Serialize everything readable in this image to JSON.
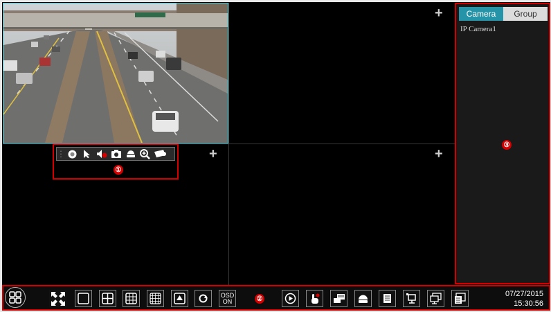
{
  "sidebar": {
    "tabs": [
      {
        "label": "Camera",
        "active": true
      },
      {
        "label": "Group",
        "active": false
      }
    ],
    "items": [
      {
        "label": "IP Camera1"
      }
    ]
  },
  "markers": [
    "①",
    "②",
    "③"
  ],
  "add_icon": "+",
  "bottombar": {
    "osd_line1": "OSD",
    "osd_line2": "ON",
    "date": "07/27/2015",
    "time": "15:30:56"
  },
  "colors": {
    "accent": "#2594a8",
    "highlight": "#d40000",
    "video_border": "#4fc6d6"
  },
  "icons": {
    "popup_toolbar": [
      "drag-handle-icon",
      "record-icon",
      "cursor-icon",
      "mute-icon",
      "snapshot-icon",
      "ptz-icon",
      "zoom-icon",
      "camera-move-icon"
    ],
    "bottom_toolbar": [
      "start-menu-icon",
      "fullscreen-icon",
      "layout-1-icon",
      "layout-4-icon",
      "layout-9-icon",
      "layout-16-icon",
      "layout-custom-icon",
      "sequence-icon",
      "osd-toggle-icon",
      "playback-icon",
      "manual-alarm-icon",
      "record-status-icon",
      "disk-icon",
      "backup-icon",
      "network-icon",
      "monitor-icon",
      "info-icon"
    ]
  }
}
